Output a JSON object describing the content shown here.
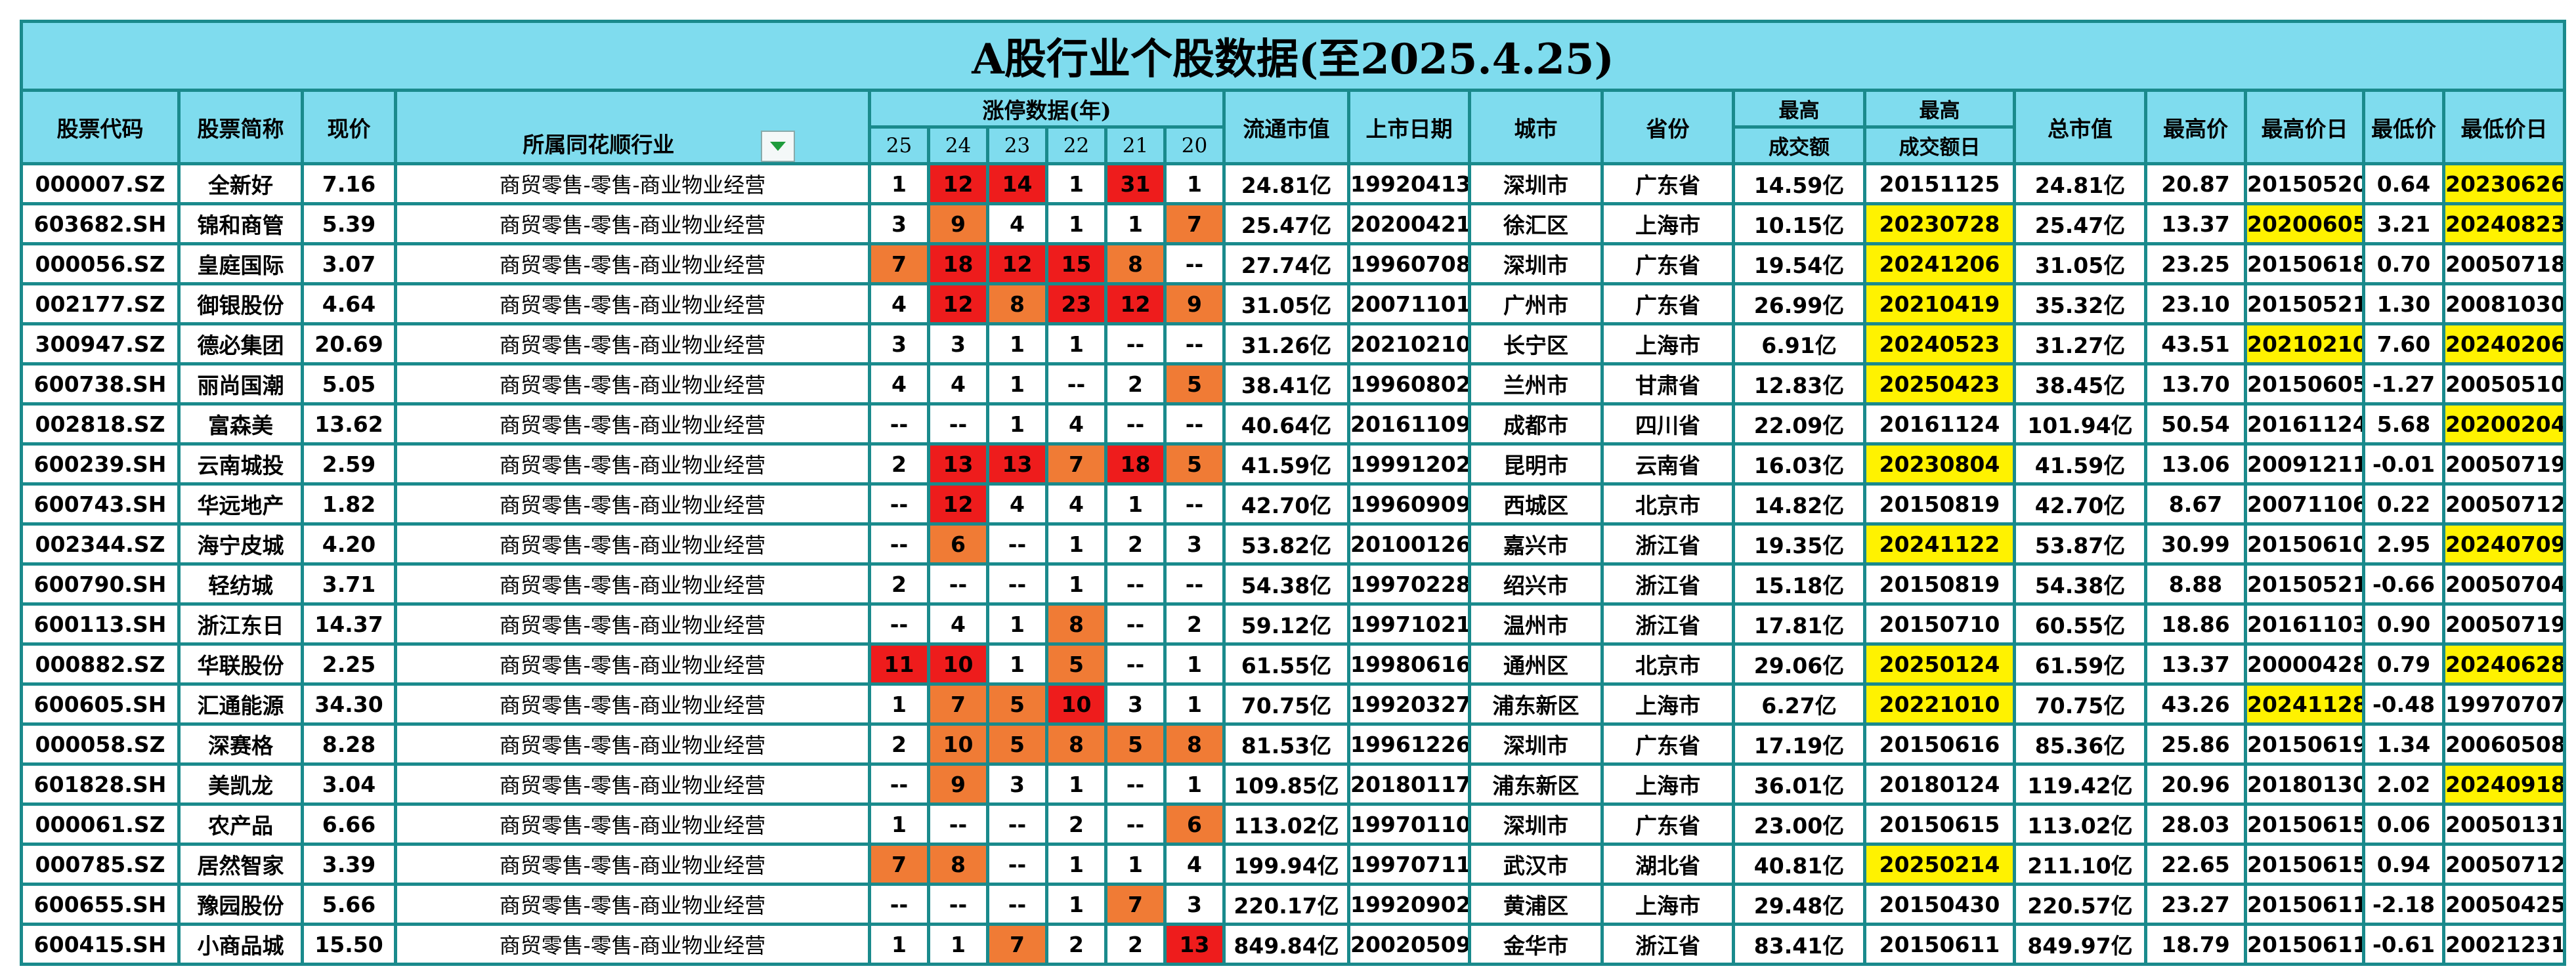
{
  "title": "A股行业个股数据(至2025.4.25)",
  "headers": {
    "code": "股票代码",
    "name": "股票简称",
    "price": "现价",
    "industry": "所属同花顺行业",
    "limit_up": "涨停数据(年)",
    "years": [
      "25",
      "24",
      "23",
      "22",
      "21",
      "20"
    ],
    "float_cap": "流通市值",
    "list_date": "上市日期",
    "city": "城市",
    "province": "省份",
    "max_turnover_top": "最高",
    "max_turnover_bottom": "成交额",
    "max_turnover_day_top": "最高",
    "max_turnover_day_bottom": "成交额日",
    "total_cap": "总市值",
    "high_price": "最高价",
    "high_date": "最高价日",
    "low_price": "最低价",
    "low_date": "最低价日"
  },
  "filter_icon": "dropdown-filter-icon",
  "colors": {
    "header_bg": "#7fdcee",
    "border": "#1a8a8c",
    "red": "#ee1c1c",
    "orange": "#f07b35",
    "yellow": "#fff200"
  },
  "rows": [
    {
      "code": "000007.SZ",
      "name": "全新好",
      "price": "7.16",
      "industry": "商贸零售-零售-商业物业经营",
      "lu": [
        "1",
        "12",
        "14",
        "1",
        "31",
        "1"
      ],
      "luc": [
        "",
        "r",
        "r",
        "",
        "r",
        ""
      ],
      "float_cap": "24.81亿",
      "list_date": "19920413",
      "city": "深圳市",
      "province": "广东省",
      "max_turnover": "14.59亿",
      "max_turnover_day": "20151125",
      "mtd_hl": false,
      "total_cap": "24.81亿",
      "high_price": "20.87",
      "high_date": "20150520",
      "hd_hl": false,
      "low_price": "0.64",
      "low_date": "20230626",
      "ld_hl": true
    },
    {
      "code": "603682.SH",
      "name": "锦和商管",
      "price": "5.39",
      "industry": "商贸零售-零售-商业物业经营",
      "lu": [
        "3",
        "9",
        "4",
        "1",
        "1",
        "7"
      ],
      "luc": [
        "",
        "o",
        "",
        "",
        "",
        "o"
      ],
      "float_cap": "25.47亿",
      "list_date": "20200421",
      "city": "徐汇区",
      "province": "上海市",
      "max_turnover": "10.15亿",
      "max_turnover_day": "20230728",
      "mtd_hl": true,
      "total_cap": "25.47亿",
      "high_price": "13.37",
      "high_date": "20200605",
      "hd_hl": true,
      "low_price": "3.21",
      "low_date": "20240823",
      "ld_hl": true
    },
    {
      "code": "000056.SZ",
      "name": "皇庭国际",
      "price": "3.07",
      "industry": "商贸零售-零售-商业物业经营",
      "lu": [
        "7",
        "18",
        "12",
        "15",
        "8",
        "--"
      ],
      "luc": [
        "o",
        "r",
        "r",
        "r",
        "o",
        ""
      ],
      "float_cap": "27.74亿",
      "list_date": "19960708",
      "city": "深圳市",
      "province": "广东省",
      "max_turnover": "19.54亿",
      "max_turnover_day": "20241206",
      "mtd_hl": true,
      "total_cap": "31.05亿",
      "high_price": "23.25",
      "high_date": "20150618",
      "hd_hl": false,
      "low_price": "0.70",
      "low_date": "20050718",
      "ld_hl": false
    },
    {
      "code": "002177.SZ",
      "name": "御银股份",
      "price": "4.64",
      "industry": "商贸零售-零售-商业物业经营",
      "lu": [
        "4",
        "12",
        "8",
        "23",
        "12",
        "9"
      ],
      "luc": [
        "",
        "r",
        "o",
        "r",
        "r",
        "o"
      ],
      "float_cap": "31.05亿",
      "list_date": "20071101",
      "city": "广州市",
      "province": "广东省",
      "max_turnover": "26.99亿",
      "max_turnover_day": "20210419",
      "mtd_hl": true,
      "total_cap": "35.32亿",
      "high_price": "23.10",
      "high_date": "20150521",
      "hd_hl": false,
      "low_price": "1.30",
      "low_date": "20081030",
      "ld_hl": false
    },
    {
      "code": "300947.SZ",
      "name": "德必集团",
      "price": "20.69",
      "industry": "商贸零售-零售-商业物业经营",
      "lu": [
        "3",
        "3",
        "1",
        "1",
        "--",
        "--"
      ],
      "luc": [
        "",
        "",
        "",
        "",
        "",
        ""
      ],
      "float_cap": "31.26亿",
      "list_date": "20210210",
      "city": "长宁区",
      "province": "上海市",
      "max_turnover": "6.91亿",
      "max_turnover_day": "20240523",
      "mtd_hl": true,
      "total_cap": "31.27亿",
      "high_price": "43.51",
      "high_date": "20210210",
      "hd_hl": true,
      "low_price": "7.60",
      "low_date": "20240206",
      "ld_hl": true
    },
    {
      "code": "600738.SH",
      "name": "丽尚国潮",
      "price": "5.05",
      "industry": "商贸零售-零售-商业物业经营",
      "lu": [
        "4",
        "4",
        "1",
        "--",
        "2",
        "5"
      ],
      "luc": [
        "",
        "",
        "",
        "",
        "",
        "o"
      ],
      "float_cap": "38.41亿",
      "list_date": "19960802",
      "city": "兰州市",
      "province": "甘肃省",
      "max_turnover": "12.83亿",
      "max_turnover_day": "20250423",
      "mtd_hl": true,
      "total_cap": "38.45亿",
      "high_price": "13.70",
      "high_date": "20150605",
      "hd_hl": false,
      "low_price": "-1.27",
      "low_date": "20050510",
      "ld_hl": false
    },
    {
      "code": "002818.SZ",
      "name": "富森美",
      "price": "13.62",
      "industry": "商贸零售-零售-商业物业经营",
      "lu": [
        "--",
        "--",
        "1",
        "4",
        "--",
        "--"
      ],
      "luc": [
        "",
        "",
        "",
        "",
        "",
        ""
      ],
      "float_cap": "40.64亿",
      "list_date": "20161109",
      "city": "成都市",
      "province": "四川省",
      "max_turnover": "22.09亿",
      "max_turnover_day": "20161124",
      "mtd_hl": false,
      "total_cap": "101.94亿",
      "high_price": "50.54",
      "high_date": "20161124",
      "hd_hl": false,
      "low_price": "5.68",
      "low_date": "20200204",
      "ld_hl": true
    },
    {
      "code": "600239.SH",
      "name": "云南城投",
      "price": "2.59",
      "industry": "商贸零售-零售-商业物业经营",
      "lu": [
        "2",
        "13",
        "13",
        "7",
        "18",
        "5"
      ],
      "luc": [
        "",
        "r",
        "r",
        "o",
        "r",
        "o"
      ],
      "float_cap": "41.59亿",
      "list_date": "19991202",
      "city": "昆明市",
      "province": "云南省",
      "max_turnover": "16.03亿",
      "max_turnover_day": "20230804",
      "mtd_hl": true,
      "total_cap": "41.59亿",
      "high_price": "13.06",
      "high_date": "20091211",
      "hd_hl": false,
      "low_price": "-0.01",
      "low_date": "20050719",
      "ld_hl": false
    },
    {
      "code": "600743.SH",
      "name": "华远地产",
      "price": "1.82",
      "industry": "商贸零售-零售-商业物业经营",
      "lu": [
        "--",
        "12",
        "4",
        "4",
        "1",
        "--"
      ],
      "luc": [
        "",
        "r",
        "",
        "",
        "",
        ""
      ],
      "float_cap": "42.70亿",
      "list_date": "19960909",
      "city": "西城区",
      "province": "北京市",
      "max_turnover": "14.82亿",
      "max_turnover_day": "20150819",
      "mtd_hl": false,
      "total_cap": "42.70亿",
      "high_price": "8.67",
      "high_date": "20071106",
      "hd_hl": false,
      "low_price": "0.22",
      "low_date": "20050712",
      "ld_hl": false
    },
    {
      "code": "002344.SZ",
      "name": "海宁皮城",
      "price": "4.20",
      "industry": "商贸零售-零售-商业物业经营",
      "lu": [
        "--",
        "6",
        "--",
        "1",
        "2",
        "3"
      ],
      "luc": [
        "",
        "o",
        "",
        "",
        "",
        ""
      ],
      "float_cap": "53.82亿",
      "list_date": "20100126",
      "city": "嘉兴市",
      "province": "浙江省",
      "max_turnover": "19.35亿",
      "max_turnover_day": "20241122",
      "mtd_hl": true,
      "total_cap": "53.87亿",
      "high_price": "30.99",
      "high_date": "20150610",
      "hd_hl": false,
      "low_price": "2.95",
      "low_date": "20240709",
      "ld_hl": true
    },
    {
      "code": "600790.SH",
      "name": "轻纺城",
      "price": "3.71",
      "industry": "商贸零售-零售-商业物业经营",
      "lu": [
        "2",
        "--",
        "--",
        "1",
        "--",
        "--"
      ],
      "luc": [
        "",
        "",
        "",
        "",
        "",
        ""
      ],
      "float_cap": "54.38亿",
      "list_date": "19970228",
      "city": "绍兴市",
      "province": "浙江省",
      "max_turnover": "15.18亿",
      "max_turnover_day": "20150819",
      "mtd_hl": false,
      "total_cap": "54.38亿",
      "high_price": "8.88",
      "high_date": "20150521",
      "hd_hl": false,
      "low_price": "-0.66",
      "low_date": "20050704",
      "ld_hl": false
    },
    {
      "code": "600113.SH",
      "name": "浙江东日",
      "price": "14.37",
      "industry": "商贸零售-零售-商业物业经营",
      "lu": [
        "--",
        "4",
        "1",
        "8",
        "--",
        "2"
      ],
      "luc": [
        "",
        "",
        "",
        "o",
        "",
        ""
      ],
      "float_cap": "59.12亿",
      "list_date": "19971021",
      "city": "温州市",
      "province": "浙江省",
      "max_turnover": "17.81亿",
      "max_turnover_day": "20150710",
      "mtd_hl": false,
      "total_cap": "60.55亿",
      "high_price": "18.86",
      "high_date": "20161103",
      "hd_hl": false,
      "low_price": "0.90",
      "low_date": "20050719",
      "ld_hl": false
    },
    {
      "code": "000882.SZ",
      "name": "华联股份",
      "price": "2.25",
      "industry": "商贸零售-零售-商业物业经营",
      "lu": [
        "11",
        "10",
        "1",
        "5",
        "--",
        "1"
      ],
      "luc": [
        "r",
        "r",
        "",
        "o",
        "",
        ""
      ],
      "float_cap": "61.55亿",
      "list_date": "19980616",
      "city": "通州区",
      "province": "北京市",
      "max_turnover": "29.06亿",
      "max_turnover_day": "20250124",
      "mtd_hl": true,
      "total_cap": "61.59亿",
      "high_price": "13.37",
      "high_date": "20000428",
      "hd_hl": false,
      "low_price": "0.79",
      "low_date": "20240628",
      "ld_hl": true
    },
    {
      "code": "600605.SH",
      "name": "汇通能源",
      "price": "34.30",
      "industry": "商贸零售-零售-商业物业经营",
      "lu": [
        "1",
        "7",
        "5",
        "10",
        "3",
        "1"
      ],
      "luc": [
        "",
        "o",
        "o",
        "r",
        "",
        ""
      ],
      "float_cap": "70.75亿",
      "list_date": "19920327",
      "city": "浦东新区",
      "province": "上海市",
      "max_turnover": "6.27亿",
      "max_turnover_day": "20221010",
      "mtd_hl": true,
      "total_cap": "70.75亿",
      "high_price": "43.26",
      "high_date": "20241128",
      "hd_hl": true,
      "low_price": "-0.48",
      "low_date": "19970707",
      "ld_hl": false
    },
    {
      "code": "000058.SZ",
      "name": "深赛格",
      "price": "8.28",
      "industry": "商贸零售-零售-商业物业经营",
      "lu": [
        "2",
        "10",
        "5",
        "8",
        "5",
        "8"
      ],
      "luc": [
        "",
        "o",
        "o",
        "o",
        "o",
        "o"
      ],
      "float_cap": "81.53亿",
      "list_date": "19961226",
      "city": "深圳市",
      "province": "广东省",
      "max_turnover": "17.19亿",
      "max_turnover_day": "20150616",
      "mtd_hl": false,
      "total_cap": "85.36亿",
      "high_price": "25.86",
      "high_date": "20150619",
      "hd_hl": false,
      "low_price": "1.34",
      "low_date": "20060508",
      "ld_hl": false
    },
    {
      "code": "601828.SH",
      "name": "美凯龙",
      "price": "3.04",
      "industry": "商贸零售-零售-商业物业经营",
      "lu": [
        "--",
        "9",
        "3",
        "1",
        "--",
        "1"
      ],
      "luc": [
        "",
        "o",
        "",
        "",
        "",
        ""
      ],
      "float_cap": "109.85亿",
      "list_date": "20180117",
      "city": "浦东新区",
      "province": "上海市",
      "max_turnover": "36.01亿",
      "max_turnover_day": "20180124",
      "mtd_hl": false,
      "total_cap": "119.42亿",
      "high_price": "20.96",
      "high_date": "20180130",
      "hd_hl": false,
      "low_price": "2.02",
      "low_date": "20240918",
      "ld_hl": true
    },
    {
      "code": "000061.SZ",
      "name": "农产品",
      "price": "6.66",
      "industry": "商贸零售-零售-商业物业经营",
      "lu": [
        "1",
        "--",
        "--",
        "2",
        "--",
        "6"
      ],
      "luc": [
        "",
        "",
        "",
        "",
        "",
        "o"
      ],
      "float_cap": "113.02亿",
      "list_date": "19970110",
      "city": "深圳市",
      "province": "广东省",
      "max_turnover": "23.00亿",
      "max_turnover_day": "20150615",
      "mtd_hl": false,
      "total_cap": "113.02亿",
      "high_price": "28.03",
      "high_date": "20150615",
      "hd_hl": false,
      "low_price": "0.06",
      "low_date": "20050131",
      "ld_hl": false
    },
    {
      "code": "000785.SZ",
      "name": "居然智家",
      "price": "3.39",
      "industry": "商贸零售-零售-商业物业经营",
      "lu": [
        "7",
        "8",
        "--",
        "1",
        "1",
        "4"
      ],
      "luc": [
        "o",
        "o",
        "",
        "",
        "",
        ""
      ],
      "float_cap": "199.94亿",
      "list_date": "19970711",
      "city": "武汉市",
      "province": "湖北省",
      "max_turnover": "40.81亿",
      "max_turnover_day": "20250214",
      "mtd_hl": true,
      "total_cap": "211.10亿",
      "high_price": "22.65",
      "high_date": "20150615",
      "hd_hl": false,
      "low_price": "0.94",
      "low_date": "20050712",
      "ld_hl": false
    },
    {
      "code": "600655.SH",
      "name": "豫园股份",
      "price": "5.66",
      "industry": "商贸零售-零售-商业物业经营",
      "lu": [
        "--",
        "--",
        "--",
        "1",
        "7",
        "3"
      ],
      "luc": [
        "",
        "",
        "",
        "",
        "o",
        ""
      ],
      "float_cap": "220.17亿",
      "list_date": "19920902",
      "city": "黄浦区",
      "province": "上海市",
      "max_turnover": "29.48亿",
      "max_turnover_day": "20150430",
      "mtd_hl": false,
      "total_cap": "220.57亿",
      "high_price": "23.27",
      "high_date": "20150611",
      "hd_hl": false,
      "low_price": "-2.18",
      "low_date": "20050425",
      "ld_hl": false
    },
    {
      "code": "600415.SH",
      "name": "小商品城",
      "price": "15.50",
      "industry": "商贸零售-零售-商业物业经营",
      "lu": [
        "1",
        "1",
        "7",
        "2",
        "2",
        "13"
      ],
      "luc": [
        "",
        "",
        "o",
        "",
        "",
        "r"
      ],
      "float_cap": "849.84亿",
      "list_date": "20020509",
      "city": "金华市",
      "province": "浙江省",
      "max_turnover": "83.41亿",
      "max_turnover_day": "20150611",
      "mtd_hl": false,
      "total_cap": "849.97亿",
      "high_price": "18.79",
      "high_date": "20150611",
      "hd_hl": false,
      "low_price": "-0.61",
      "low_date": "20021231",
      "ld_hl": false
    }
  ]
}
